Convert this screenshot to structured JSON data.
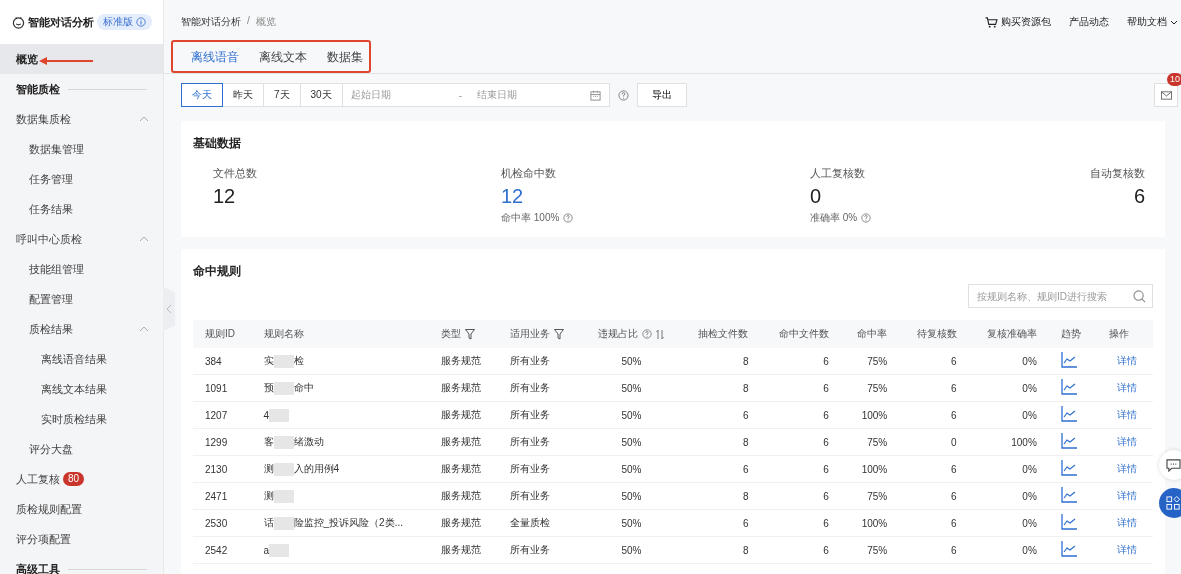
{
  "brand": {
    "title": "智能对话分析",
    "edition": "标准版"
  },
  "sidebar": {
    "items": [
      {
        "kind": "item",
        "label": "概览",
        "selected": true
      },
      {
        "kind": "section",
        "label": "智能质检"
      },
      {
        "kind": "group",
        "label": "数据集质检",
        "expanded": true,
        "children": [
          {
            "label": "数据集管理"
          },
          {
            "label": "任务管理"
          },
          {
            "label": "任务结果"
          }
        ]
      },
      {
        "kind": "group",
        "label": "呼叫中心质检",
        "expanded": true,
        "children": [
          {
            "label": "技能组管理"
          },
          {
            "label": "配置管理"
          },
          {
            "label": "质检结果",
            "expanded": true,
            "children": [
              {
                "label": "离线语音结果"
              },
              {
                "label": "离线文本结果"
              },
              {
                "label": "实时质检结果"
              }
            ]
          },
          {
            "label": "评分大盘"
          }
        ]
      },
      {
        "kind": "item",
        "label": "人工复核",
        "selected": false,
        "badge": "80"
      },
      {
        "kind": "item",
        "label": "质检规则配置",
        "selected": false
      },
      {
        "kind": "item",
        "label": "评分项配置",
        "selected": false
      },
      {
        "kind": "section",
        "label": "高级工具"
      }
    ]
  },
  "breadcrumb": [
    "智能对话分析",
    "概览"
  ],
  "breadcrumb_separator": "/",
  "header_links": [
    {
      "kind": "cart",
      "label": "购买资源包"
    },
    {
      "kind": "plain",
      "label": "产品动态"
    },
    {
      "kind": "menu",
      "label": "帮助文档"
    }
  ],
  "tabs": [
    {
      "label": "离线语音",
      "selected": true
    },
    {
      "label": "离线文本",
      "selected": false
    },
    {
      "label": "数据集",
      "selected": false
    }
  ],
  "date_filter": {
    "ranges": [
      {
        "label": "今天",
        "selected": true
      },
      {
        "label": "昨天",
        "selected": false
      },
      {
        "label": "7天",
        "selected": false
      },
      {
        "label": "30天",
        "selected": false
      }
    ],
    "start_placeholder": "起始日期",
    "separator": "-",
    "end_placeholder": "结束日期",
    "export": "导出"
  },
  "notifications": {
    "badge": "10"
  },
  "basic_data": {
    "title": "基础数据",
    "stats": [
      {
        "label": "文件总数",
        "value": "12",
        "highlight": false
      },
      {
        "label": "机检命中数",
        "value": "12",
        "highlight": true,
        "note": "命中率 100%"
      },
      {
        "label": "人工复核数",
        "value": "0",
        "highlight": false,
        "note": "准确率 0%"
      },
      {
        "label": "自动复核数",
        "value": "6",
        "highlight": false
      }
    ]
  },
  "hit_rules": {
    "title": "命中规则",
    "search": {
      "placeholder": "按规则名称、规则ID进行搜索"
    },
    "columns": [
      {
        "label": "规则ID",
        "kind": "plain"
      },
      {
        "label": "规则名称",
        "kind": "plain"
      },
      {
        "label": "类型",
        "kind": "filter"
      },
      {
        "label": "适用业务",
        "kind": "filter"
      },
      {
        "label": "违规占比",
        "kind": "help-sort"
      },
      {
        "label": "抽检文件数",
        "kind": "plain"
      },
      {
        "label": "命中文件数",
        "kind": "plain"
      },
      {
        "label": "命中率",
        "kind": "plain"
      },
      {
        "label": "待复核数",
        "kind": "plain"
      },
      {
        "label": "复核准确率",
        "kind": "plain"
      },
      {
        "label": "趋势",
        "kind": "plain"
      },
      {
        "label": "操作",
        "kind": "plain"
      }
    ],
    "rows": [
      {
        "id": "384",
        "name_start": "实",
        "name_end": "检",
        "type": "服务规范",
        "business": "所有业务",
        "ratio": "50%",
        "sampled": "8",
        "hit": "6",
        "rate": "75%",
        "pending": "6",
        "accuracy": "0%",
        "action": "详情"
      },
      {
        "id": "1091",
        "name_start": "预",
        "name_end": "命中",
        "type": "服务规范",
        "business": "所有业务",
        "ratio": "50%",
        "sampled": "8",
        "hit": "6",
        "rate": "75%",
        "pending": "6",
        "accuracy": "0%",
        "action": "详情"
      },
      {
        "id": "1207",
        "name_start": "4",
        "name_end": "",
        "type": "服务规范",
        "business": "所有业务",
        "ratio": "50%",
        "sampled": "6",
        "hit": "6",
        "rate": "100%",
        "pending": "6",
        "accuracy": "0%",
        "action": "详情"
      },
      {
        "id": "1299",
        "name_start": "客",
        "name_end": "绪激动",
        "type": "服务规范",
        "business": "所有业务",
        "ratio": "50%",
        "sampled": "8",
        "hit": "6",
        "rate": "75%",
        "pending": "0",
        "accuracy": "100%",
        "action": "详情"
      },
      {
        "id": "2130",
        "name_start": "测",
        "name_end": "入的用例4",
        "type": "服务规范",
        "business": "所有业务",
        "ratio": "50%",
        "sampled": "6",
        "hit": "6",
        "rate": "100%",
        "pending": "6",
        "accuracy": "0%",
        "action": "详情"
      },
      {
        "id": "2471",
        "name_start": "测",
        "name_end": "",
        "type": "服务规范",
        "business": "所有业务",
        "ratio": "50%",
        "sampled": "8",
        "hit": "6",
        "rate": "75%",
        "pending": "6",
        "accuracy": "0%",
        "action": "详情"
      },
      {
        "id": "2530",
        "name_start": "话",
        "name_end": "险监控_投诉风险（2类...",
        "type": "服务规范",
        "business": "全量质检",
        "ratio": "50%",
        "sampled": "6",
        "hit": "6",
        "rate": "100%",
        "pending": "6",
        "accuracy": "0%",
        "action": "详情"
      },
      {
        "id": "2542",
        "name_start": "a",
        "name_end": "",
        "type": "服务规范",
        "business": "所有业务",
        "ratio": "50%",
        "sampled": "8",
        "hit": "6",
        "rate": "75%",
        "pending": "6",
        "accuracy": "0%",
        "action": "详情"
      }
    ]
  }
}
